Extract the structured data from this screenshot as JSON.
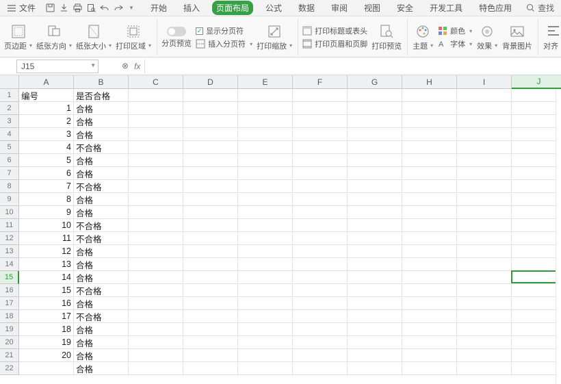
{
  "menu": {
    "file": "文件",
    "tabs": [
      "开始",
      "插入",
      "页面布局",
      "公式",
      "数据",
      "审阅",
      "视图",
      "安全",
      "开发工具",
      "特色应用"
    ],
    "active_tab": 2,
    "search": "查找"
  },
  "ribbon": {
    "margins": "页边距",
    "orientation": "纸张方向",
    "size": "纸张大小",
    "print_area": "打印区域",
    "page_break_preview": "分页预览",
    "show_page_break": "显示分页符",
    "insert_page_break": "插入分页符",
    "print_scaling": "打印缩放",
    "print_titles": "打印标题或表头",
    "print_header_footer": "打印页眉和页脚",
    "print_preview": "打印预览",
    "themes": "主题",
    "colors": "颜色",
    "fonts": "字体",
    "effects": "效果",
    "bg_image": "背景图片",
    "align": "对齐"
  },
  "namebox": "J15",
  "columns": [
    "A",
    "B",
    "C",
    "D",
    "E",
    "F",
    "G",
    "H",
    "I",
    "J"
  ],
  "header_row": {
    "A": "编号",
    "B": "是否合格"
  },
  "rows": [
    {
      "a": 1,
      "b": "合格"
    },
    {
      "a": 2,
      "b": "合格"
    },
    {
      "a": 3,
      "b": "合格"
    },
    {
      "a": 4,
      "b": "不合格"
    },
    {
      "a": 5,
      "b": "合格"
    },
    {
      "a": 6,
      "b": "合格"
    },
    {
      "a": 7,
      "b": "不合格"
    },
    {
      "a": 8,
      "b": "合格"
    },
    {
      "a": 9,
      "b": "合格"
    },
    {
      "a": 10,
      "b": "不合格"
    },
    {
      "a": 11,
      "b": "不合格"
    },
    {
      "a": 12,
      "b": "合格"
    },
    {
      "a": 13,
      "b": "合格"
    },
    {
      "a": 14,
      "b": "合格"
    },
    {
      "a": 15,
      "b": "不合格"
    },
    {
      "a": 16,
      "b": "合格"
    },
    {
      "a": 17,
      "b": "不合格"
    },
    {
      "a": 18,
      "b": "合格"
    },
    {
      "a": 19,
      "b": "合格"
    },
    {
      "a": 20,
      "b": "合格"
    },
    {
      "a": "",
      "b": "合格"
    }
  ],
  "selected": {
    "row": 15,
    "col": "J"
  },
  "icons": {
    "menu": "menu-icon",
    "save": "save-icon",
    "print": "print-icon",
    "preview": "print-preview-icon",
    "export": "export-icon",
    "undo": "undo-icon",
    "redo": "redo-icon",
    "search": "search-icon"
  }
}
